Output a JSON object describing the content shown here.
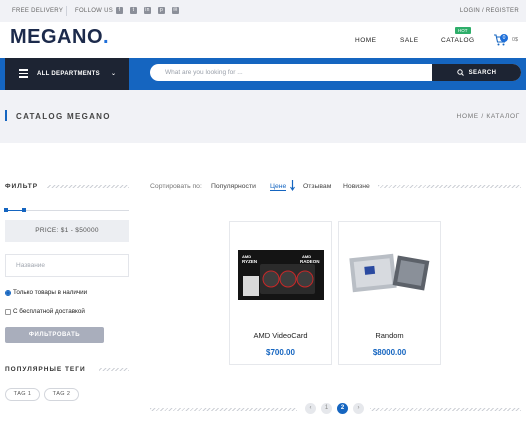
{
  "topbar": {
    "free_delivery": "FREE DELIVERY",
    "follow_us": "FOLLOW US",
    "socials": [
      "facebook-icon",
      "twitter-icon",
      "linkedin-icon",
      "pinterest-icon",
      "mail-icon"
    ],
    "auth": "LOGIN / REGISTER"
  },
  "header": {
    "logo_text": "MEGANO",
    "logo_dot": ".",
    "nav": {
      "home": "HOME",
      "sale": "SALE",
      "catalog": "CATALOG",
      "hot_badge": "HOT"
    },
    "cart": {
      "count": "0",
      "sum": "0$"
    }
  },
  "departments": {
    "label": "ALL DEPARTMENTS"
  },
  "search": {
    "placeholder": "What are you looking for ...",
    "value": "",
    "button": "SEARCH"
  },
  "banner": {
    "title": "CATALOG MEGANO",
    "breadcrumb": [
      "HOME",
      "/",
      "КАТАЛОГ"
    ]
  },
  "filter": {
    "title": "ФИЛЬТР",
    "price_range": {
      "min_fraction": 0.0,
      "max_fraction": 0.15
    },
    "price_label": "PRICE:  $1 - $50000",
    "name_placeholder": "Название",
    "only_in_stock": "Только товары в наличии",
    "free_delivery": "С бесплатной доставкой",
    "in_stock_checked": true,
    "free_delivery_checked": false,
    "button": "ФИЛЬТРОВАТЬ"
  },
  "tags": {
    "title": "ПОПУЛЯРНЫЕ ТЕГИ",
    "items": [
      "ТАG 1",
      "ТАG 2"
    ]
  },
  "sort": {
    "label": "Сортировать по:",
    "options": [
      "Популярности",
      "Цене",
      "Отзывам",
      "Новизне"
    ],
    "active": "Цене"
  },
  "products": [
    {
      "name": "AMD VideoCard",
      "price": "$700.00"
    },
    {
      "name": "Random",
      "price": "$8000.00"
    }
  ],
  "pagination": {
    "prev": "‹",
    "pages": [
      "1",
      "2"
    ],
    "current": "2",
    "next": "›"
  },
  "colors": {
    "accent": "#1565c0",
    "dark": "#1d2433",
    "hot": "#2eae6a",
    "band": "#f1f2f6"
  }
}
